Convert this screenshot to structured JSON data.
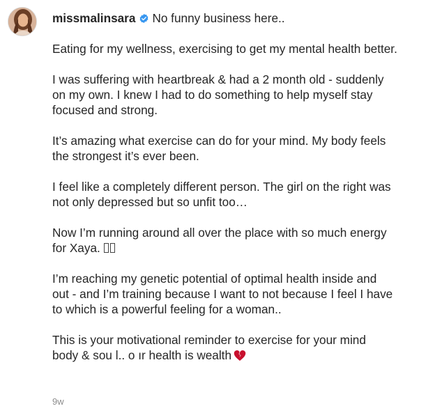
{
  "post": {
    "username": "missmalinsara",
    "verified": true,
    "header_text": "No funny business here..",
    "paragraphs": [
      "Eating for my wellness, exercising to get my mental health better.",
      "I was suffering with heartbreak & had a 2 month old - suddenly\non my own. I knew I had to do something to help myself stay\nfocused and strong.",
      "It’s amazing what exercise can do for your mind. My body feels\nthe strongest it’s ever been.",
      "I feel like a completely different person. The girl on the right was\nnot only depressed but so unfit too…",
      "Now I’m running around all over the place with so much energy\nfor Xaya.",
      "I’m reaching my genetic potential of optimal health inside and\nout - and I’m training because I want to not because I feel I have\nto which is a powerful feeling for a woman..",
      "This is your motivational reminder to exercise for your mind\nbody & so\u0005l.. \u0005 ır health is wealth"
    ],
    "last_line_text": "This is your motivational reminder to exercise for your mind\nbody & sou l.. o ır health is wealth",
    "timestamp": "9w"
  },
  "icons": {
    "verified": "verified-badge-icon",
    "avatar": "profile-avatar",
    "emoji_placeholder": "missing-emoji-glyph",
    "heart": "broken-heart-icon"
  },
  "colors": {
    "text": "#262626",
    "verified_blue": "#3897f0",
    "timestamp": "#8e8e8e",
    "heart": "#c8102e"
  }
}
